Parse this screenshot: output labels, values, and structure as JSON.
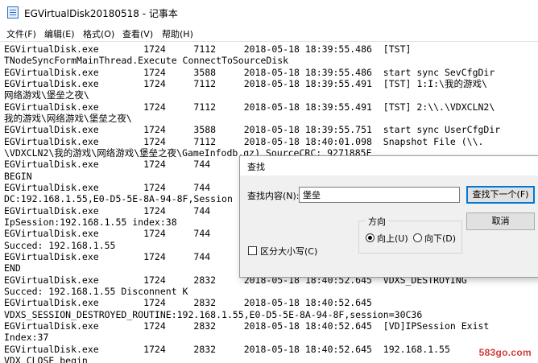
{
  "window": {
    "title": "EGVirtualDisk20180518 - 记事本"
  },
  "menu": [
    {
      "label": "文件(F)"
    },
    {
      "label": "编辑(E)"
    },
    {
      "label": "格式(O)"
    },
    {
      "label": "查看(V)"
    },
    {
      "label": "帮助(H)"
    }
  ],
  "lines": [
    "EGVirtualDisk.exe        1724     7112     2018-05-18 18:39:55.486  [TST]",
    "TNodeSyncFormMainThread.Execute ConnectToSourceDisk",
    "EGVirtualDisk.exe        1724     3588     2018-05-18 18:39:55.486  start sync SevCfgDir",
    "EGVirtualDisk.exe        1724     7112     2018-05-18 18:39:55.491  [TST] 1:I:\\我的游戏\\",
    "网络游戏\\堡垒之夜\\",
    "EGVirtualDisk.exe        1724     7112     2018-05-18 18:39:55.491  [TST] 2:\\\\.\\VDXCLN2\\",
    "我的游戏\\网络游戏\\堡垒之夜\\",
    "EGVirtualDisk.exe        1724     3588     2018-05-18 18:39:55.751  start sync UserCfgDir",
    "EGVirtualDisk.exe        1724     7112     2018-05-18 18:40:01.098  Snapshot File (\\\\.",
    "\\VDXCLN2\\我的游戏\\网络游戏\\堡垒之夜\\GameInfodb.gz) SourceCRC: 9271885F",
    "EGVirtualDisk.exe        1724     744",
    "BEGIN",
    "EGVirtualDisk.exe        1724     744",
    "DC:192.168.1.55,E0-D5-5E-8A-94-8F,Session",
    "EGVirtualDisk.exe        1724     744",
    "IpSession:192.168.1.55 index:38",
    "EGVirtualDisk.exe        1724     744",
    "Succed: 192.168.1.55",
    "EGVirtualDisk.exe        1724     744",
    "END",
    "EGVirtualDisk.exe        1724     2832     2018-05-18 18:40:52.645  VDXS_DESTROYING",
    "Succed: 192.168.1.55 Disconnent K",
    "EGVirtualDisk.exe        1724     2832     2018-05-18 18:40:52.645",
    "VDXS_SESSION_DESTROYED_ROUTINE:192.168.1.55,E0-D5-5E-8A-94-8F,session=30C36",
    "EGVirtualDisk.exe        1724     2832     2018-05-18 18:40:52.645  [VD]IPSession Exist",
    "Index:37",
    "EGVirtualDisk.exe        1724     2832     2018-05-18 18:40:52.645  192.168.1.55",
    "VDX_CLOSE begin"
  ],
  "find_dialog": {
    "title": "查找",
    "find_label": "查找内容(N):",
    "find_value": "堡垒",
    "find_next_label": "查找下一个(F)",
    "cancel_label": "取消",
    "direction_label": "方向",
    "up_label": "向上(U)",
    "down_label": "向下(D)",
    "match_case_label": "区分大小写(C)",
    "direction_selected": "up",
    "match_case_checked": false
  },
  "watermark": "583go.com"
}
